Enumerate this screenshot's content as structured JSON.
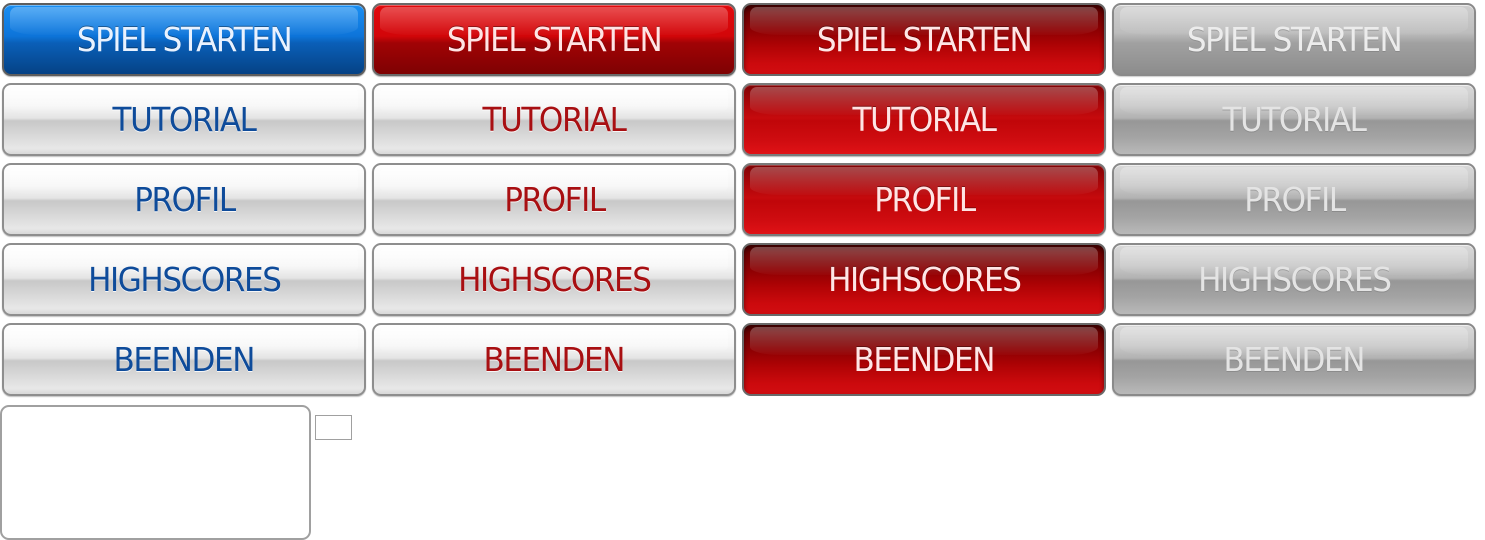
{
  "menu": {
    "columns": [
      {
        "state": "normal-blue",
        "buttons": [
          {
            "label": "SPIEL STARTEN"
          },
          {
            "label": "TUTORIAL"
          },
          {
            "label": "PROFIL"
          },
          {
            "label": "HIGHSCORES"
          },
          {
            "label": "BEENDEN"
          }
        ]
      },
      {
        "state": "normal-red",
        "buttons": [
          {
            "label": "SPIEL STARTEN"
          },
          {
            "label": "TUTORIAL"
          },
          {
            "label": "PROFIL"
          },
          {
            "label": "HIGHSCORES"
          },
          {
            "label": "BEENDEN"
          }
        ]
      },
      {
        "state": "hover-red",
        "buttons": [
          {
            "label": "SPIEL STARTEN"
          },
          {
            "label": "TUTORIAL"
          },
          {
            "label": "PROFIL"
          },
          {
            "label": "HIGHSCORES"
          },
          {
            "label": "BEENDEN"
          }
        ]
      },
      {
        "state": "disabled",
        "buttons": [
          {
            "label": "SPIEL STARTEN"
          },
          {
            "label": "TUTORIAL"
          },
          {
            "label": "PROFIL"
          },
          {
            "label": "HIGHSCORES"
          },
          {
            "label": "BEENDEN"
          }
        ]
      }
    ]
  },
  "colors": {
    "blue_text": "#0e4b9a",
    "red_text": "#a80f12",
    "blue_button": "#0d74d9",
    "red_button": "#c60a0d",
    "grey_button": "#b2b2b2"
  }
}
